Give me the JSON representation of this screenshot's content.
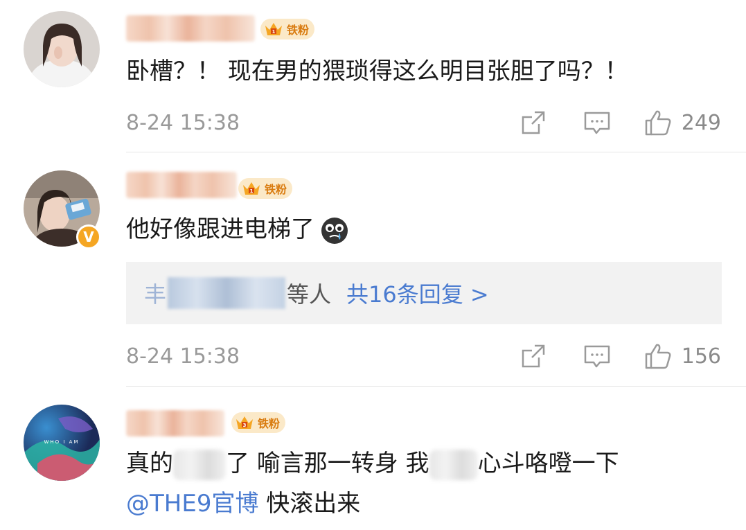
{
  "badge_label": "铁粉",
  "comments": [
    {
      "text": "卧槽？！ 现在男的猥琐得这么明目张胆了吗？！",
      "time": "8-24 15:38",
      "likes": "249"
    },
    {
      "text": "他好像跟进电梯了",
      "time": "8-24 15:38",
      "likes": "156",
      "emoji": "crying-face",
      "reply_summary": {
        "prefix": "丰",
        "others": "等人",
        "link": "共16条回复 >"
      }
    },
    {
      "text_part1": "真的",
      "text_part2": "了 喻言那一转身 我",
      "text_part3": "心斗咯噔一下",
      "mention": "@THE9官博",
      "text_line2": " 快滚出来"
    }
  ],
  "colors": {
    "link": "#4a7bd0",
    "muted": "#999999",
    "badge_bg": "#fbe9c8",
    "badge_text": "#d97b0f",
    "verified": "#f5a623"
  }
}
